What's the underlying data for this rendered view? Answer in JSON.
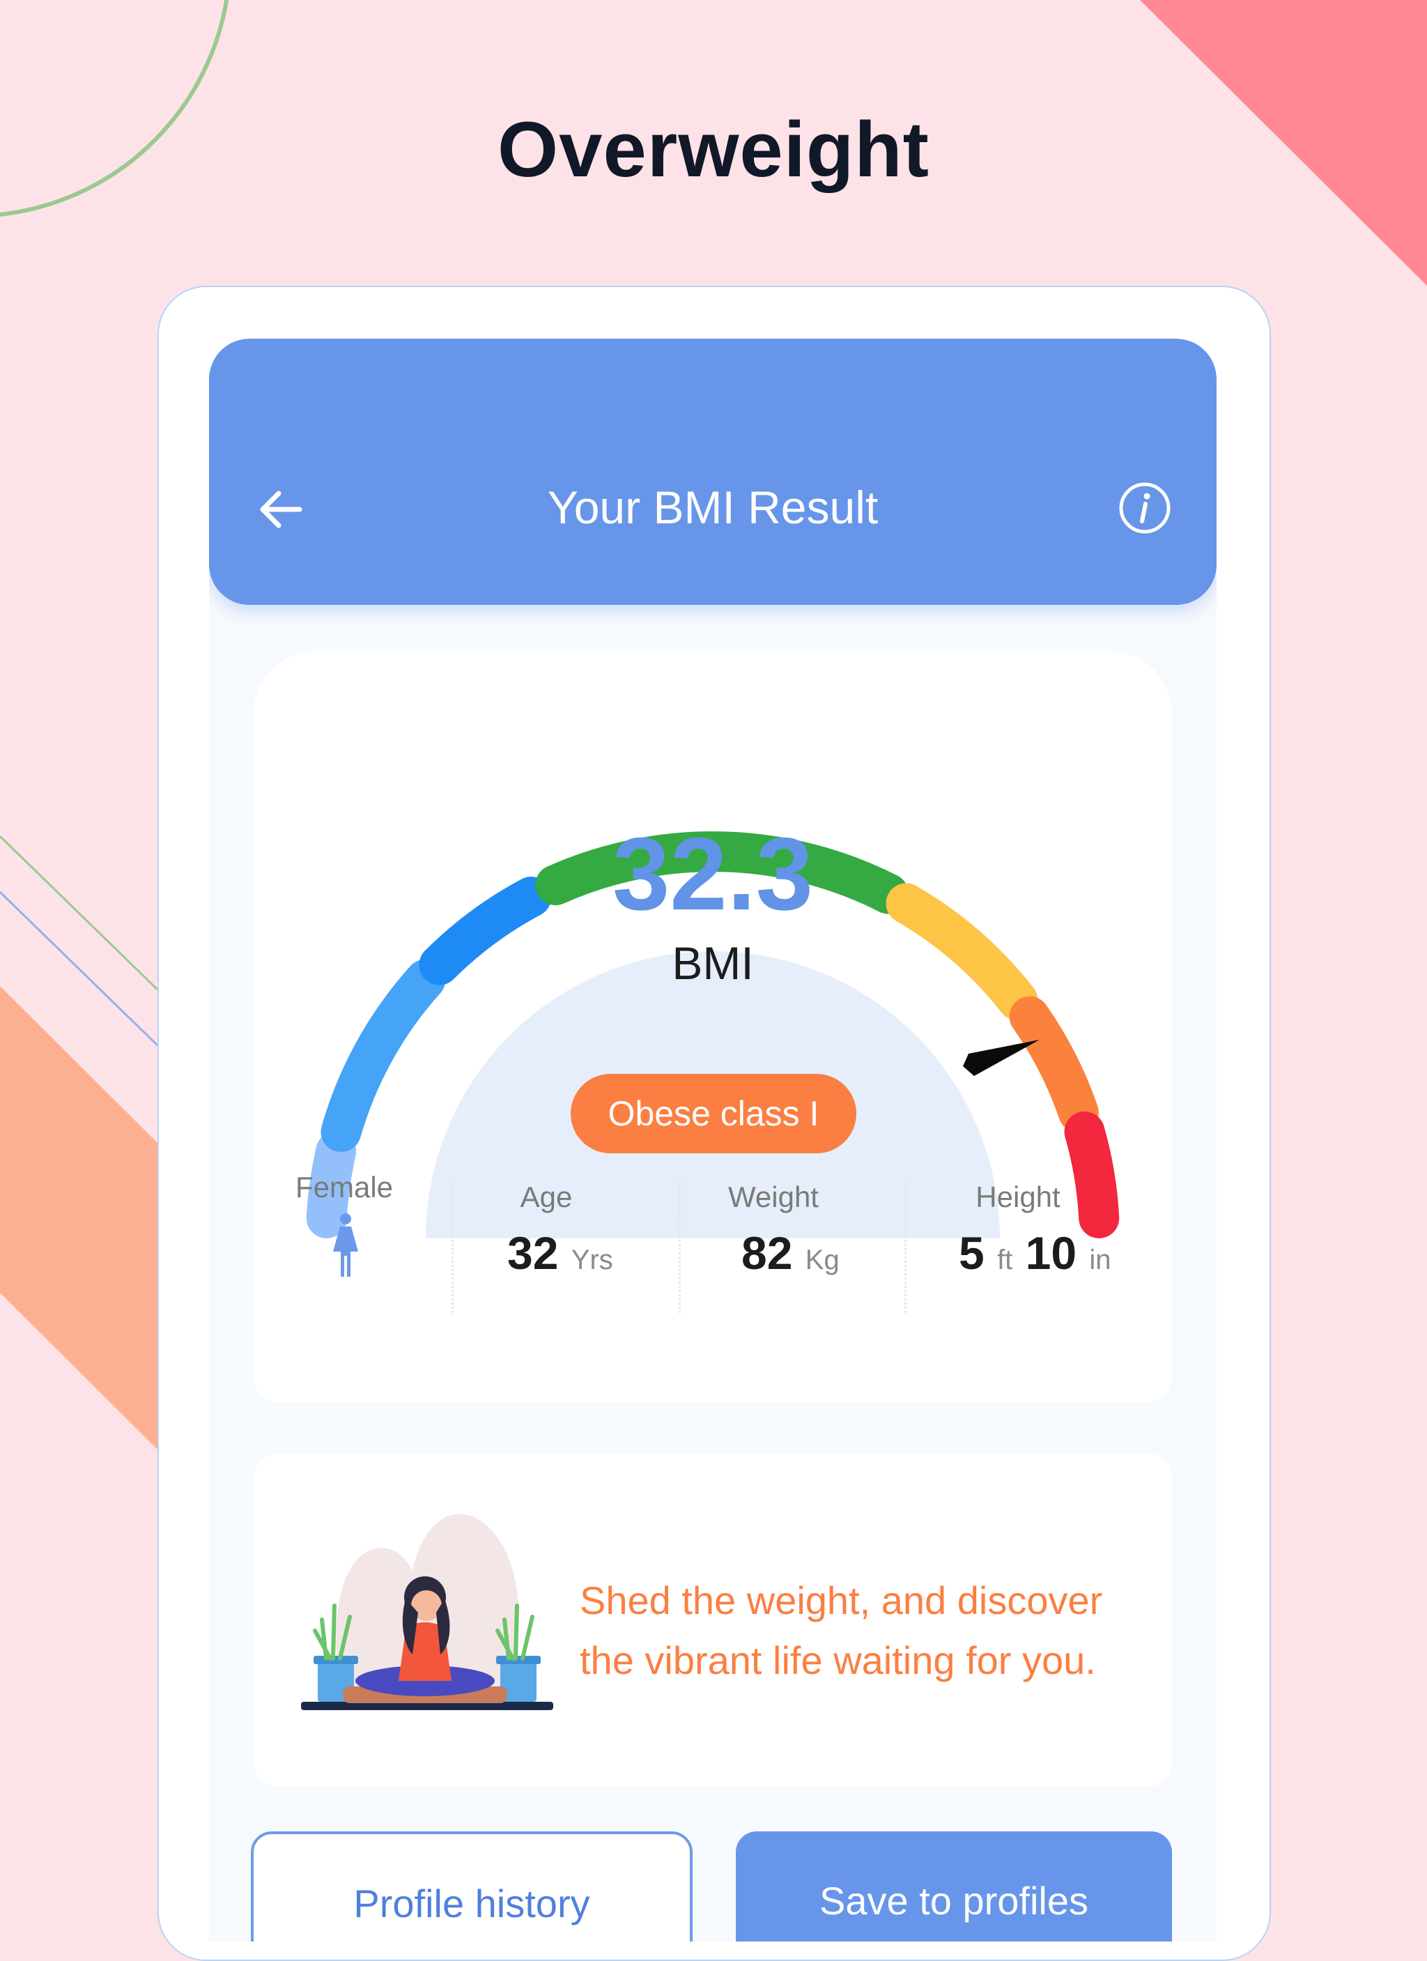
{
  "headline": "Overweight",
  "colors": {
    "background": "#fde3e8",
    "accent_blue": "#6795e9",
    "accent_orange": "#fb7f42",
    "bmi_value": "#6194e6"
  },
  "appbar": {
    "title": "Your BMI Result",
    "back_icon": "arrow-left-icon",
    "info_icon": "info-icon"
  },
  "result": {
    "bmi_value": "32.3",
    "bmi_label": "BMI",
    "category": "Obese class I",
    "gauge_segment_colors": [
      "#93c0fa",
      "#45a3f8",
      "#1e8af6",
      "#35a942",
      "#fdc445",
      "#fa823c",
      "#f3273d"
    ]
  },
  "stats": {
    "gender_label": "Female",
    "gender_icon": "female-icon",
    "age": {
      "label": "Age",
      "value": "32",
      "unit": "Yrs"
    },
    "weight": {
      "label": "Weight",
      "value": "82",
      "unit": "Kg"
    },
    "height": {
      "label": "Height",
      "feet": "5",
      "feet_unit": "ft",
      "inches": "10",
      "inches_unit": "in"
    }
  },
  "tip": {
    "line1": "Shed the weight, and discover",
    "line2": "the vibrant life waiting for you."
  },
  "buttons": {
    "profile_history": "Profile history",
    "save_to_profiles": "Save to profiles"
  }
}
